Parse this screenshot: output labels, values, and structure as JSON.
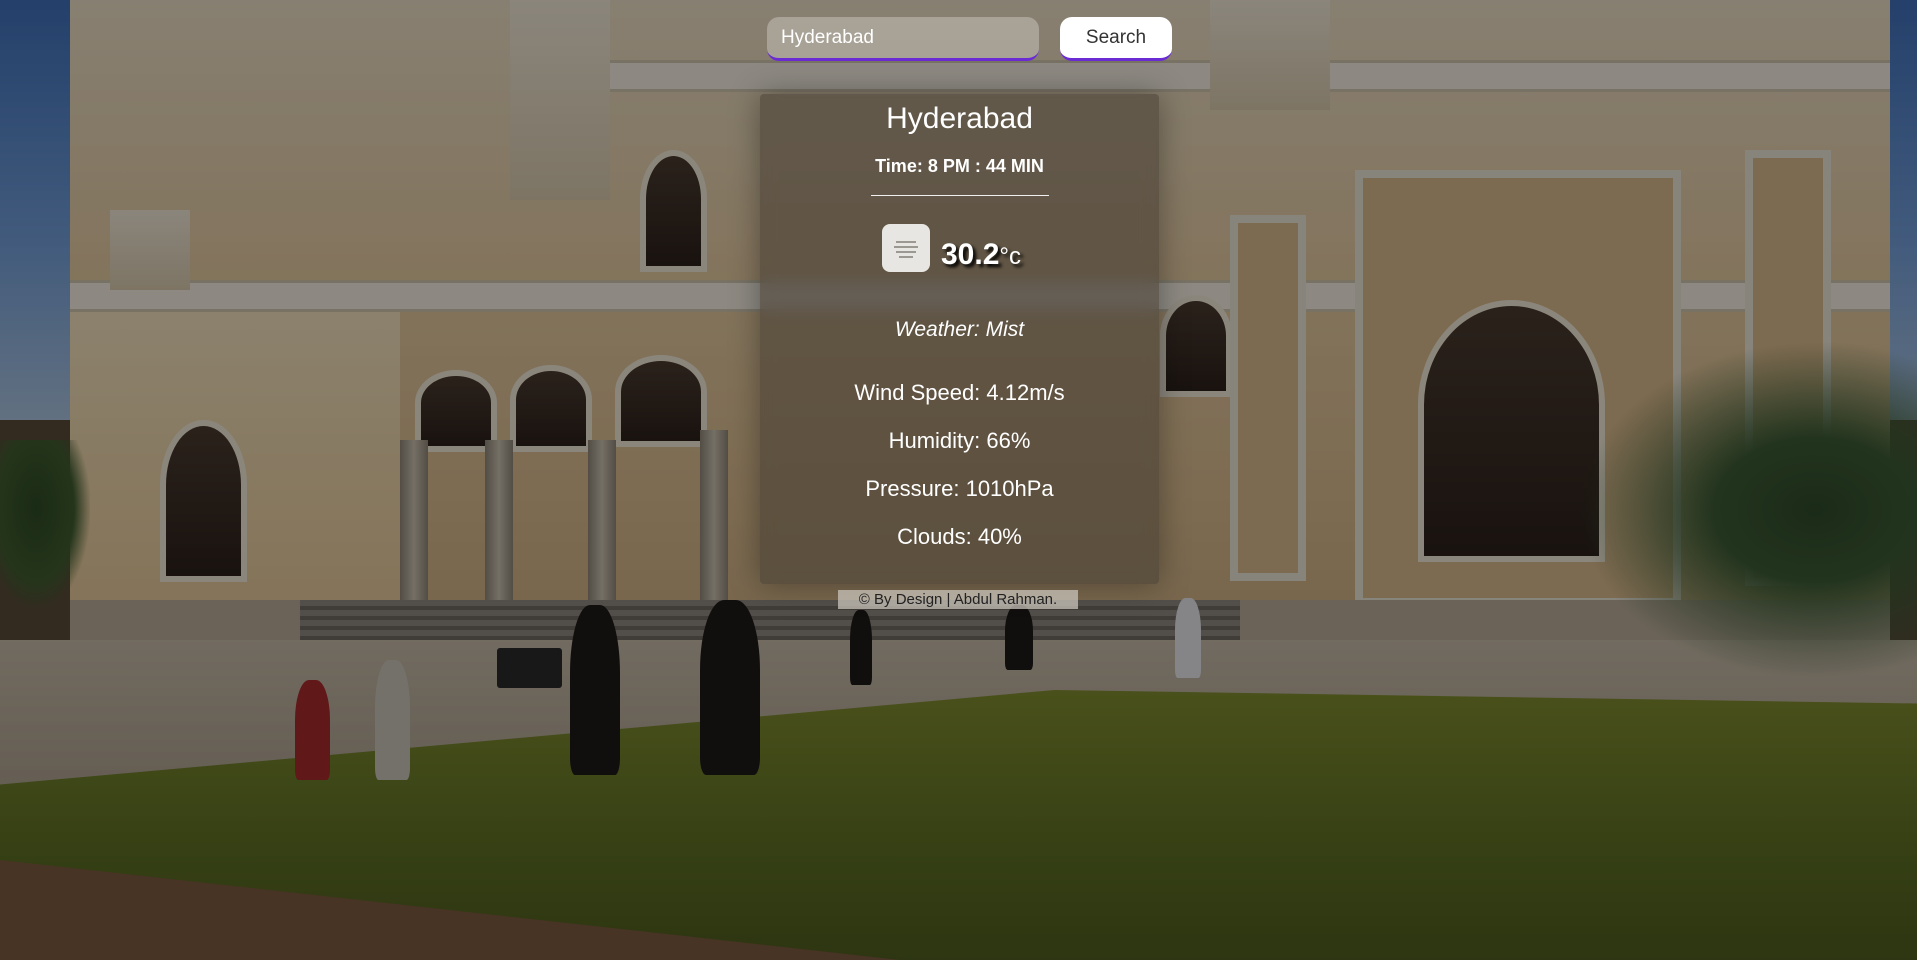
{
  "search": {
    "value": "Hyderabad",
    "button_label": "Search"
  },
  "weather": {
    "city": "Hyderabad",
    "time": "Time: 8 PM : 44 MIN",
    "icon": "mist-icon",
    "temperature": "30.2",
    "unit": "°c",
    "description": "Weather: Mist",
    "wind_speed": "Wind Speed: 4.12m/s",
    "humidity": "Humidity: 66%",
    "pressure": "Pressure: 1010hPa",
    "clouds": "Clouds: 40%"
  },
  "footer": {
    "credit": "© By Design | Abdul Rahman."
  },
  "colors": {
    "accent": "#6a2bd4",
    "card_background": "rgba(70,60,50,0.55)"
  }
}
